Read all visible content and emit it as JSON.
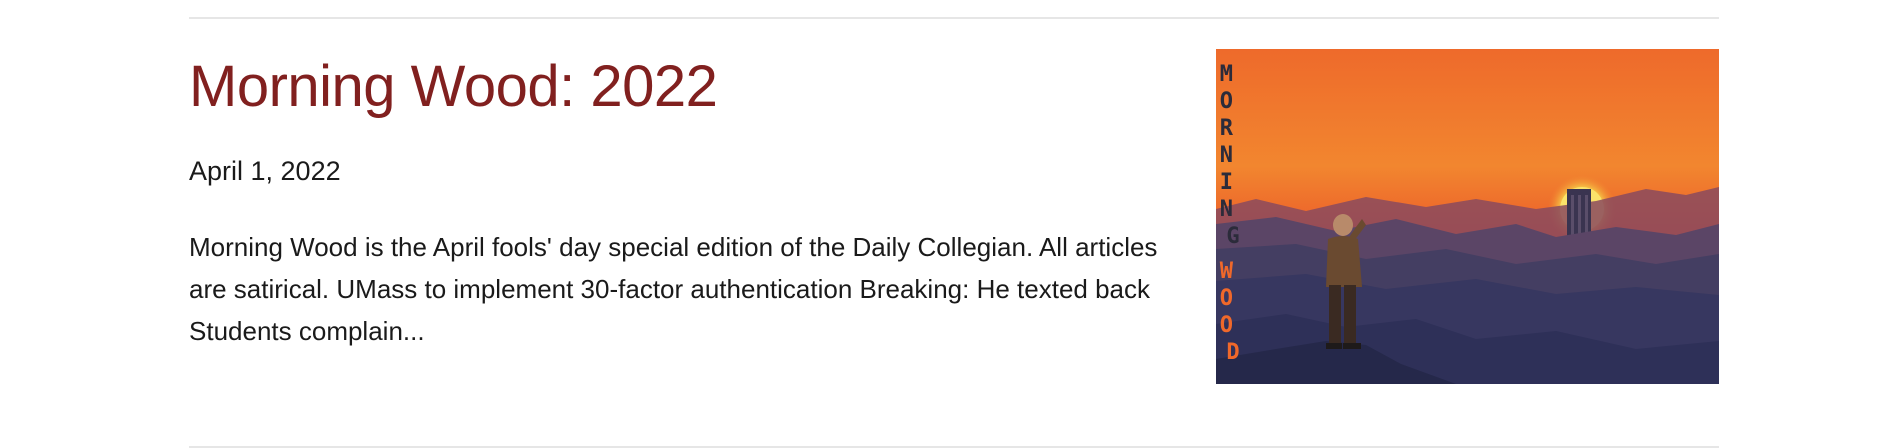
{
  "article": {
    "title": "Morning Wood: 2022",
    "date": "April 1, 2022",
    "excerpt": "Morning Wood is the April fools' day special edition of the Daily Collegian. All articles are satirical.  UMass to implement 30-factor authentication Breaking: He texted back Students complain...",
    "image": {
      "vertical_text_top": "MORNING",
      "vertical_text_bottom": "WOOD",
      "colors": {
        "sky_top": "#ef6a2a",
        "sky_mid": "#f2852f",
        "sky_horizon": "#e6532a",
        "mountains_far": "#7a4a60",
        "mountains_mid": "#4f4466",
        "mountains_near": "#2e2f52",
        "sun": "#f7e36a",
        "text_top": "#2b2b3a",
        "text_bottom": "#ef6a2a"
      }
    }
  },
  "colors": {
    "title": "#81201f",
    "text": "#1a1a1a",
    "divider": "#e6e6e6"
  }
}
